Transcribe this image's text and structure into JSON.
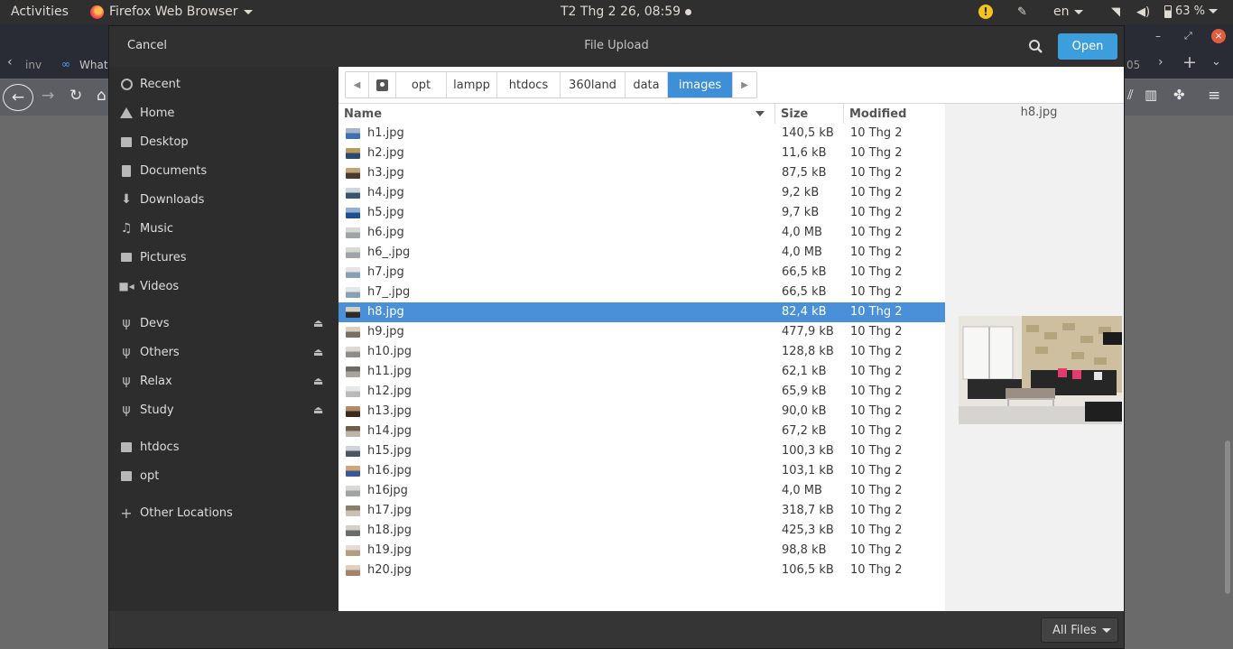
{
  "top_panel": {
    "activities": "Activities",
    "app_name": "Firefox Web Browser",
    "clock": "T2 Thg 2 26, 08:59",
    "lang": "en",
    "battery": "63 %"
  },
  "browser": {
    "tab_fragment_1": "inv",
    "tab_fragment_2": "What",
    "tab_fragment_3": "05"
  },
  "dialog": {
    "cancel_label": "Cancel",
    "title": "File Upload",
    "open_label": "Open",
    "filter_label": "All Files"
  },
  "sidebar": {
    "items": [
      {
        "label": "Recent",
        "icon": "clock-icon"
      },
      {
        "label": "Home",
        "icon": "home-icon"
      },
      {
        "label": "Desktop",
        "icon": "folder-icon"
      },
      {
        "label": "Documents",
        "icon": "document-icon"
      },
      {
        "label": "Downloads",
        "icon": "download-icon"
      },
      {
        "label": "Music",
        "icon": "music-icon"
      },
      {
        "label": "Pictures",
        "icon": "camera-icon"
      },
      {
        "label": "Videos",
        "icon": "video-icon"
      },
      {
        "label": "Devs",
        "icon": "usb-icon"
      },
      {
        "label": "Others",
        "icon": "usb-icon"
      },
      {
        "label": "Relax",
        "icon": "usb-icon"
      },
      {
        "label": "Study",
        "icon": "usb-icon"
      },
      {
        "label": "htdocs",
        "icon": "folder-icon"
      },
      {
        "label": "opt",
        "icon": "folder-icon"
      },
      {
        "label": "Other Locations",
        "icon": "plus-icon"
      }
    ]
  },
  "pathbar": {
    "crumbs": [
      "opt",
      "lampp",
      "htdocs",
      "360land",
      "data",
      "images"
    ],
    "active": "images"
  },
  "columns": {
    "name": "Name",
    "size": "Size",
    "modified": "Modified"
  },
  "files": [
    {
      "name": "h1.jpg",
      "size": "140,5 kB",
      "modified": "10 Thg 2"
    },
    {
      "name": "h2.jpg",
      "size": "11,6 kB",
      "modified": "10 Thg 2"
    },
    {
      "name": "h3.jpg",
      "size": "87,5 kB",
      "modified": "10 Thg 2"
    },
    {
      "name": "h4.jpg",
      "size": "9,2 kB",
      "modified": "10 Thg 2"
    },
    {
      "name": "h5.jpg",
      "size": "9,7 kB",
      "modified": "10 Thg 2"
    },
    {
      "name": "h6.jpg",
      "size": "4,0 MB",
      "modified": "10 Thg 2"
    },
    {
      "name": "h6_.jpg",
      "size": "4,0 MB",
      "modified": "10 Thg 2"
    },
    {
      "name": "h7.jpg",
      "size": "66,5 kB",
      "modified": "10 Thg 2"
    },
    {
      "name": "h7_.jpg",
      "size": "66,5 kB",
      "modified": "10 Thg 2"
    },
    {
      "name": "h8.jpg",
      "size": "82,4 kB",
      "modified": "10 Thg 2"
    },
    {
      "name": "h9.jpg",
      "size": "477,9 kB",
      "modified": "10 Thg 2"
    },
    {
      "name": "h10.jpg",
      "size": "128,8 kB",
      "modified": "10 Thg 2"
    },
    {
      "name": "h11.jpg",
      "size": "62,1 kB",
      "modified": "10 Thg 2"
    },
    {
      "name": "h12.jpg",
      "size": "65,9 kB",
      "modified": "10 Thg 2"
    },
    {
      "name": "h13.jpg",
      "size": "90,0 kB",
      "modified": "10 Thg 2"
    },
    {
      "name": "h14.jpg",
      "size": "67,2 kB",
      "modified": "10 Thg 2"
    },
    {
      "name": "h15.jpg",
      "size": "100,3 kB",
      "modified": "10 Thg 2"
    },
    {
      "name": "h16.jpg",
      "size": "103,1 kB",
      "modified": "10 Thg 2"
    },
    {
      "name": "h16jpg",
      "size": "4,0 MB",
      "modified": "10 Thg 2"
    },
    {
      "name": "h17.jpg",
      "size": "318,7 kB",
      "modified": "10 Thg 2"
    },
    {
      "name": "h18.jpg",
      "size": "425,3 kB",
      "modified": "10 Thg 2"
    },
    {
      "name": "h19.jpg",
      "size": "98,8 kB",
      "modified": "10 Thg 2"
    },
    {
      "name": "h20.jpg",
      "size": "106,5 kB",
      "modified": "10 Thg 2"
    }
  ],
  "selected_file": "h8.jpg",
  "preview": {
    "filename": "h8.jpg"
  },
  "colors": {
    "selection": "#4a90d9",
    "open_button": "#3d9ede",
    "sidebar_bg": "#2d2d2d",
    "header_bg": "#303030"
  }
}
